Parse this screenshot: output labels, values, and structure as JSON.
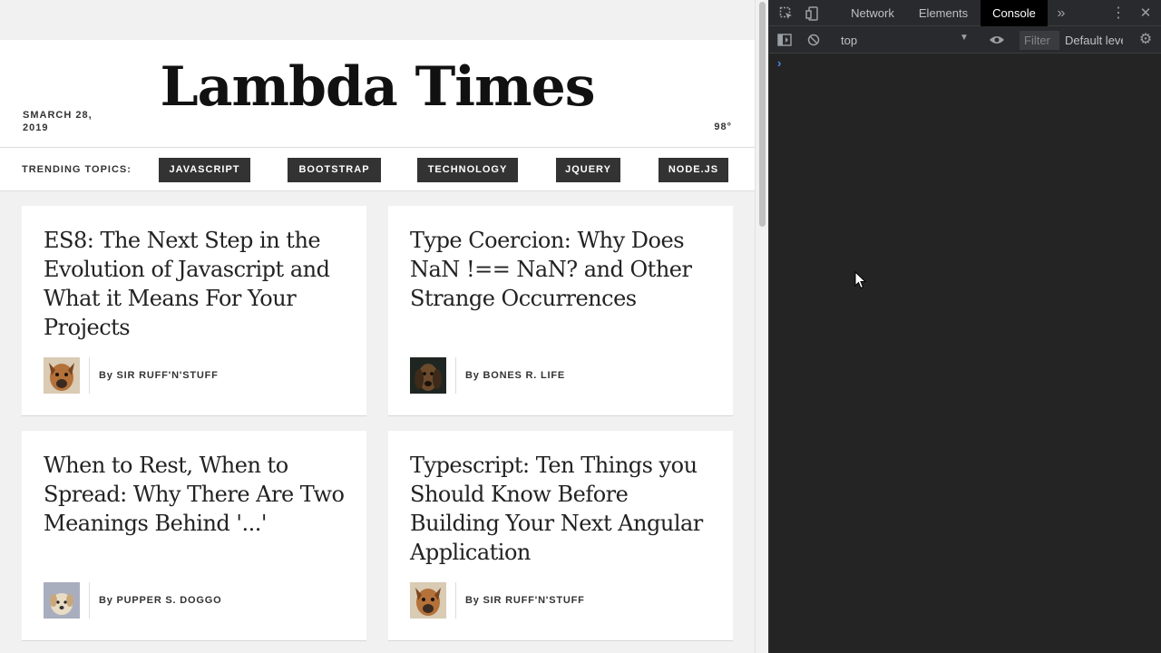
{
  "page": {
    "title": "Lambda Times",
    "date": "SMARCH 28, 2019",
    "temperature": "98°",
    "trending_label": "TRENDING TOPICS:",
    "topics": [
      "JAVASCRIPT",
      "BOOTSTRAP",
      "TECHNOLOGY",
      "JQUERY",
      "NODE.JS"
    ]
  },
  "articles": [
    {
      "headline": "ES8: The Next Step in the Evolution of Javascript and What it Means For Your Projects",
      "by": "By",
      "author": "SIR RUFF'N'STUFF"
    },
    {
      "headline": "Type Coercion: Why Does NaN !== NaN? and Other Strange Occurrences",
      "by": "By",
      "author": "BONES R. LIFE"
    },
    {
      "headline": "When to Rest, When to Spread: Why There Are Two Meanings Behind '...'",
      "by": "By",
      "author": "PUPPER S. DOGGO"
    },
    {
      "headline": "Typescript: Ten Things you Should Know Before Building Your Next Angular Application",
      "by": "By",
      "author": "SIR RUFF'N'STUFF"
    }
  ],
  "devtools": {
    "tabs": [
      "Network",
      "Elements",
      "Console"
    ],
    "active_tab": "Console",
    "more_icon": "»",
    "context": "top",
    "filter_placeholder": "Filter",
    "levels": "Default levels",
    "prompt": "›"
  },
  "colors": {
    "tag_bg": "#333333",
    "devtools_bg": "#242424",
    "prompt": "#4d8af0"
  }
}
